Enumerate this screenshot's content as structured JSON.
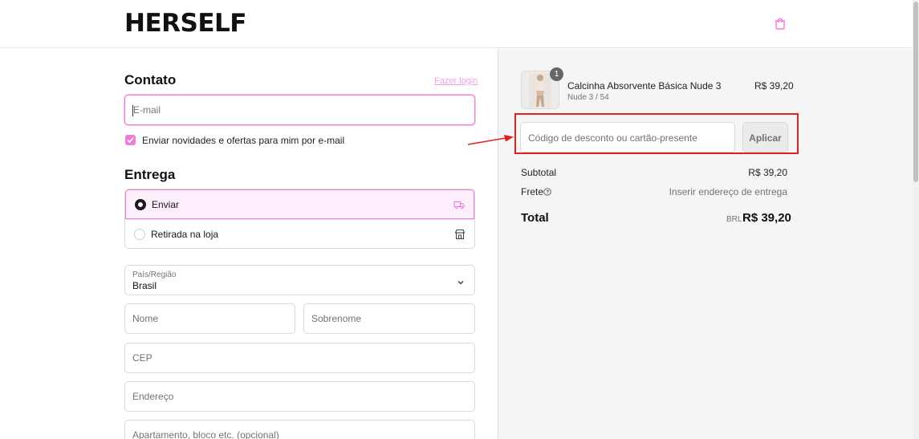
{
  "header": {
    "logo": "HERSELF",
    "cart_icon": "shopping-bag-icon"
  },
  "contact": {
    "title": "Contato",
    "login_link": "Fazer login",
    "email_placeholder": "E-mail",
    "newsletter_label": "Enviar novidades e ofertas para mim por e-mail",
    "newsletter_checked": true
  },
  "delivery": {
    "title": "Entrega",
    "options": [
      {
        "label": "Enviar",
        "selected": true,
        "icon": "truck-icon"
      },
      {
        "label": "Retirada na loja",
        "selected": false,
        "icon": "store-icon"
      }
    ],
    "country_label": "País/Região",
    "country_value": "Brasil",
    "first_name_placeholder": "Nome",
    "last_name_placeholder": "Sobrenome",
    "cep_placeholder": "CEP",
    "address_placeholder": "Endereço",
    "apartment_placeholder": "Apartamento, bloco etc. (opcional)"
  },
  "order": {
    "item": {
      "quantity": "1",
      "name": "Calcinha Absorvente Básica Nude 3",
      "variant": "Nude 3 / 54",
      "price": "R$ 39,20"
    },
    "discount_placeholder": "Código de desconto ou cartão-presente",
    "apply_label": "Aplicar",
    "subtotal_label": "Subtotal",
    "subtotal_value": "R$ 39,20",
    "shipping_label": "Frete",
    "shipping_value": "Inserir endereço de entrega",
    "total_label": "Total",
    "total_currency": "BRL",
    "total_value": "R$ 39,20"
  },
  "colors": {
    "accent": "#f07bd8",
    "annotation": "#e02020"
  }
}
